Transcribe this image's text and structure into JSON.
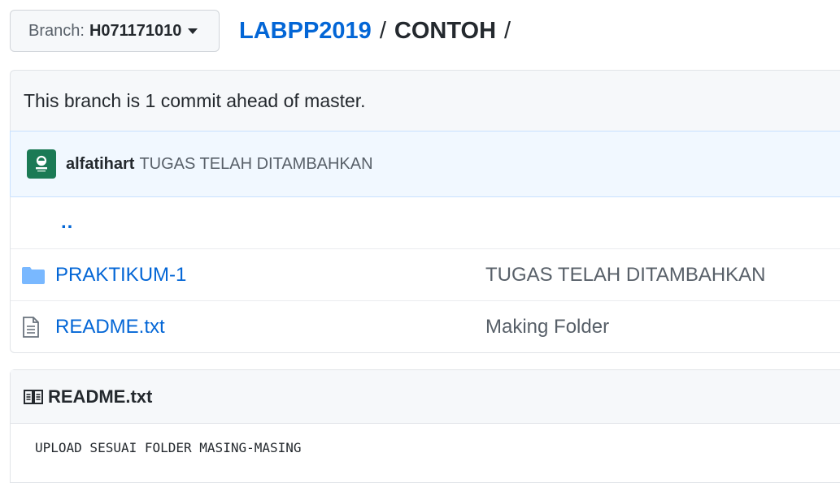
{
  "branch": {
    "prefix": "Branch:",
    "name": "H071171010"
  },
  "breadcrumb": {
    "root": "LABPP2019",
    "separator": "/",
    "current": "CONTOH",
    "trailing": "/"
  },
  "status": {
    "ahead_text": "This branch is 1 commit ahead of master."
  },
  "commit": {
    "author": "alfatihart",
    "message": "TUGAS TELAH DITAMBAHKAN",
    "avatar_color": "#1b7a55"
  },
  "files": {
    "parent": "..",
    "items": [
      {
        "name": "PRAKTIKUM-1",
        "type": "folder",
        "icon": "folder-icon",
        "message": "TUGAS TELAH DITAMBAHKAN"
      },
      {
        "name": "README.txt",
        "type": "file",
        "icon": "file-icon",
        "message": "Making Folder"
      }
    ]
  },
  "readme": {
    "title": "README.txt",
    "icon": "book-icon",
    "content": "UPLOAD SESUAI FOLDER MASING-MASING"
  },
  "colors": {
    "link": "#0366d6",
    "folder": "#79b8ff",
    "muted": "#586069"
  }
}
